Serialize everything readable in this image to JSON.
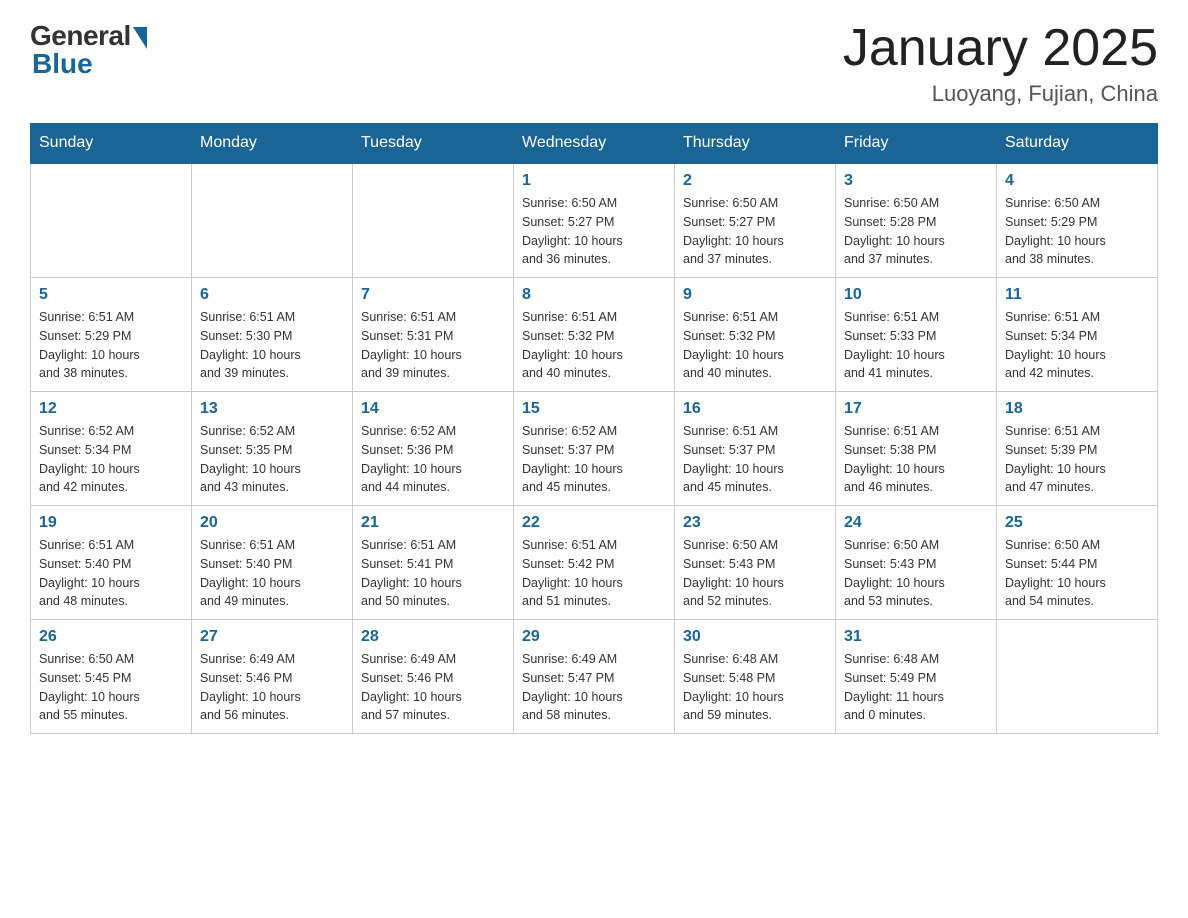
{
  "header": {
    "logo_general": "General",
    "logo_blue": "Blue",
    "title": "January 2025",
    "subtitle": "Luoyang, Fujian, China"
  },
  "days_of_week": [
    "Sunday",
    "Monday",
    "Tuesday",
    "Wednesday",
    "Thursday",
    "Friday",
    "Saturday"
  ],
  "weeks": [
    [
      {
        "day": "",
        "info": ""
      },
      {
        "day": "",
        "info": ""
      },
      {
        "day": "",
        "info": ""
      },
      {
        "day": "1",
        "info": "Sunrise: 6:50 AM\nSunset: 5:27 PM\nDaylight: 10 hours\nand 36 minutes."
      },
      {
        "day": "2",
        "info": "Sunrise: 6:50 AM\nSunset: 5:27 PM\nDaylight: 10 hours\nand 37 minutes."
      },
      {
        "day": "3",
        "info": "Sunrise: 6:50 AM\nSunset: 5:28 PM\nDaylight: 10 hours\nand 37 minutes."
      },
      {
        "day": "4",
        "info": "Sunrise: 6:50 AM\nSunset: 5:29 PM\nDaylight: 10 hours\nand 38 minutes."
      }
    ],
    [
      {
        "day": "5",
        "info": "Sunrise: 6:51 AM\nSunset: 5:29 PM\nDaylight: 10 hours\nand 38 minutes."
      },
      {
        "day": "6",
        "info": "Sunrise: 6:51 AM\nSunset: 5:30 PM\nDaylight: 10 hours\nand 39 minutes."
      },
      {
        "day": "7",
        "info": "Sunrise: 6:51 AM\nSunset: 5:31 PM\nDaylight: 10 hours\nand 39 minutes."
      },
      {
        "day": "8",
        "info": "Sunrise: 6:51 AM\nSunset: 5:32 PM\nDaylight: 10 hours\nand 40 minutes."
      },
      {
        "day": "9",
        "info": "Sunrise: 6:51 AM\nSunset: 5:32 PM\nDaylight: 10 hours\nand 40 minutes."
      },
      {
        "day": "10",
        "info": "Sunrise: 6:51 AM\nSunset: 5:33 PM\nDaylight: 10 hours\nand 41 minutes."
      },
      {
        "day": "11",
        "info": "Sunrise: 6:51 AM\nSunset: 5:34 PM\nDaylight: 10 hours\nand 42 minutes."
      }
    ],
    [
      {
        "day": "12",
        "info": "Sunrise: 6:52 AM\nSunset: 5:34 PM\nDaylight: 10 hours\nand 42 minutes."
      },
      {
        "day": "13",
        "info": "Sunrise: 6:52 AM\nSunset: 5:35 PM\nDaylight: 10 hours\nand 43 minutes."
      },
      {
        "day": "14",
        "info": "Sunrise: 6:52 AM\nSunset: 5:36 PM\nDaylight: 10 hours\nand 44 minutes."
      },
      {
        "day": "15",
        "info": "Sunrise: 6:52 AM\nSunset: 5:37 PM\nDaylight: 10 hours\nand 45 minutes."
      },
      {
        "day": "16",
        "info": "Sunrise: 6:51 AM\nSunset: 5:37 PM\nDaylight: 10 hours\nand 45 minutes."
      },
      {
        "day": "17",
        "info": "Sunrise: 6:51 AM\nSunset: 5:38 PM\nDaylight: 10 hours\nand 46 minutes."
      },
      {
        "day": "18",
        "info": "Sunrise: 6:51 AM\nSunset: 5:39 PM\nDaylight: 10 hours\nand 47 minutes."
      }
    ],
    [
      {
        "day": "19",
        "info": "Sunrise: 6:51 AM\nSunset: 5:40 PM\nDaylight: 10 hours\nand 48 minutes."
      },
      {
        "day": "20",
        "info": "Sunrise: 6:51 AM\nSunset: 5:40 PM\nDaylight: 10 hours\nand 49 minutes."
      },
      {
        "day": "21",
        "info": "Sunrise: 6:51 AM\nSunset: 5:41 PM\nDaylight: 10 hours\nand 50 minutes."
      },
      {
        "day": "22",
        "info": "Sunrise: 6:51 AM\nSunset: 5:42 PM\nDaylight: 10 hours\nand 51 minutes."
      },
      {
        "day": "23",
        "info": "Sunrise: 6:50 AM\nSunset: 5:43 PM\nDaylight: 10 hours\nand 52 minutes."
      },
      {
        "day": "24",
        "info": "Sunrise: 6:50 AM\nSunset: 5:43 PM\nDaylight: 10 hours\nand 53 minutes."
      },
      {
        "day": "25",
        "info": "Sunrise: 6:50 AM\nSunset: 5:44 PM\nDaylight: 10 hours\nand 54 minutes."
      }
    ],
    [
      {
        "day": "26",
        "info": "Sunrise: 6:50 AM\nSunset: 5:45 PM\nDaylight: 10 hours\nand 55 minutes."
      },
      {
        "day": "27",
        "info": "Sunrise: 6:49 AM\nSunset: 5:46 PM\nDaylight: 10 hours\nand 56 minutes."
      },
      {
        "day": "28",
        "info": "Sunrise: 6:49 AM\nSunset: 5:46 PM\nDaylight: 10 hours\nand 57 minutes."
      },
      {
        "day": "29",
        "info": "Sunrise: 6:49 AM\nSunset: 5:47 PM\nDaylight: 10 hours\nand 58 minutes."
      },
      {
        "day": "30",
        "info": "Sunrise: 6:48 AM\nSunset: 5:48 PM\nDaylight: 10 hours\nand 59 minutes."
      },
      {
        "day": "31",
        "info": "Sunrise: 6:48 AM\nSunset: 5:49 PM\nDaylight: 11 hours\nand 0 minutes."
      },
      {
        "day": "",
        "info": ""
      }
    ]
  ]
}
